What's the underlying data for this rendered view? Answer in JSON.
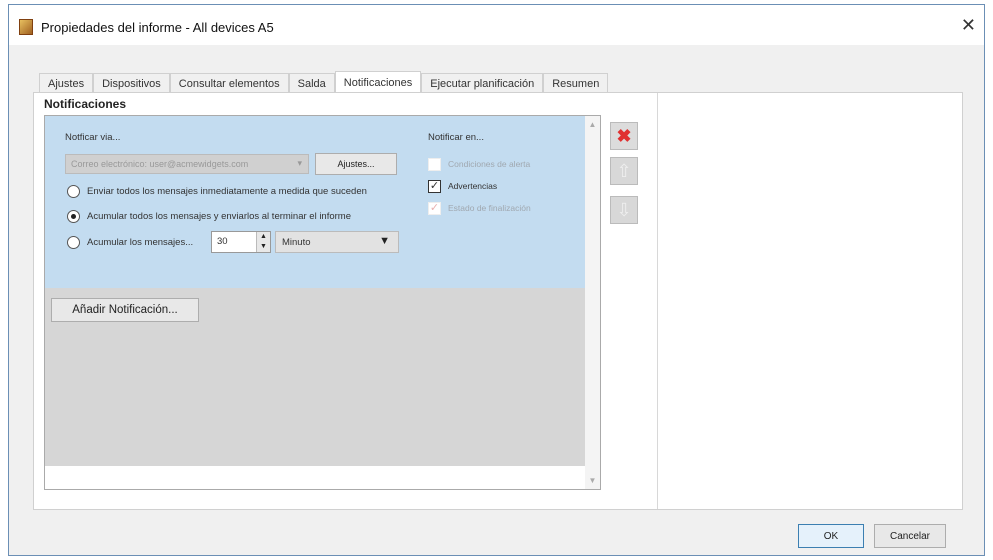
{
  "window": {
    "title": "Propiedades del informe - All devices A5",
    "close": "✕"
  },
  "tabs": [
    "Ajustes",
    "Dispositivos",
    "Consultar elementos",
    "Salda",
    "Notificaciones",
    "Ejecutar planificación",
    "Resumen"
  ],
  "active_tab": "Notificaciones",
  "group_label": "Notificaciones",
  "notification": {
    "notify_via_label": "Notficar via...",
    "notify_via_value": "Correo electrónico: user@acmewidgets.com",
    "settings_button": "Ajustes...",
    "options": [
      {
        "label": "Enviar todos los mensajes inmediatamente a medida que suceden",
        "selected": false
      },
      {
        "label": "Acumular todos los mensajes y enviarlos al terminar el informe",
        "selected": true
      },
      {
        "label": "Acumular los mensajes...",
        "selected": false
      }
    ],
    "interval_value": "30",
    "interval_unit": "Minuto",
    "notify_on_label": "Notificar en...",
    "notify_on": [
      {
        "label": "Condiciones de alerta",
        "checked": false,
        "enabled": false
      },
      {
        "label": "Advertencias",
        "checked": true,
        "enabled": true
      },
      {
        "label": "Estado de finalización",
        "checked": true,
        "enabled": false
      }
    ]
  },
  "add_button": "Añadir Notificación...",
  "footer": {
    "ok": "OK",
    "cancel": "Cancelar"
  }
}
